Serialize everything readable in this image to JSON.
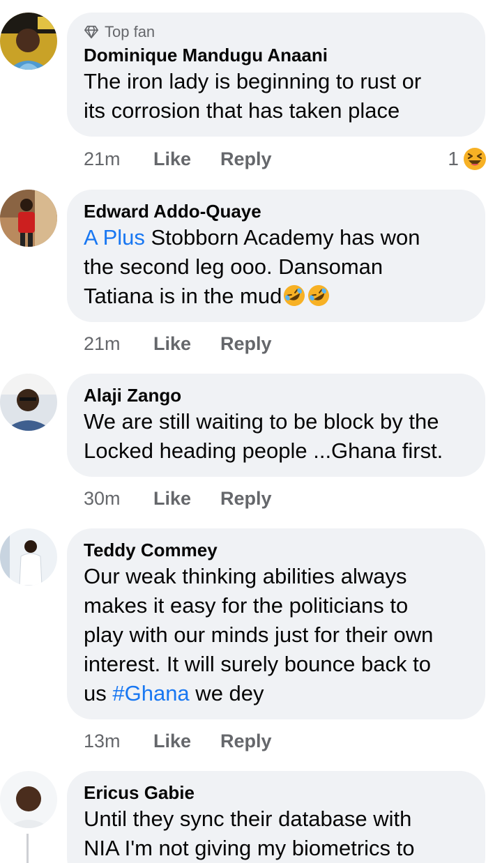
{
  "comments": [
    {
      "badge": "Top fan",
      "author": "Dominique Mandugu Anaani",
      "lines": [
        "The iron lady is beginning to rust or",
        "its corrosion that has taken place"
      ],
      "time": "21m",
      "like": "Like",
      "reply": "Reply",
      "reaction_count": "1",
      "reaction_icon": "laughing-face-icon"
    },
    {
      "author": "Edward Addo-Quaye",
      "mention": "A Plus",
      "line1_rest": " Stobborn Academy has won",
      "line2": "the second leg ooo. Dansoman",
      "line3": "Tatiana is in the mud",
      "emoji_icon": "rolling-on-floor-laughing-icon",
      "time": "21m",
      "like": "Like",
      "reply": "Reply"
    },
    {
      "author": "Alaji Zango",
      "lines": [
        "We are still waiting to be block by the",
        "Locked heading people ...Ghana first."
      ],
      "time": "30m",
      "like": "Like",
      "reply": "Reply"
    },
    {
      "author": "Teddy Commey",
      "lines": [
        "Our weak thinking abilities always",
        "makes it easy for the politicians to",
        "play with our minds just for their own",
        "interest. It will surely bounce back to"
      ],
      "line5_start": "us ",
      "hashtag": "#Ghana",
      "line5_end": " we dey",
      "time": "13m",
      "like": "Like",
      "reply": "Reply"
    },
    {
      "author": "Ericus Gabie",
      "lines": [
        "Until they sync their database with",
        "NIA I'm not giving my biometrics to"
      ]
    }
  ],
  "colors": {
    "bubble": "#f0f2f5",
    "link": "#1877f2",
    "meta": "#65676b",
    "text": "#050505"
  }
}
